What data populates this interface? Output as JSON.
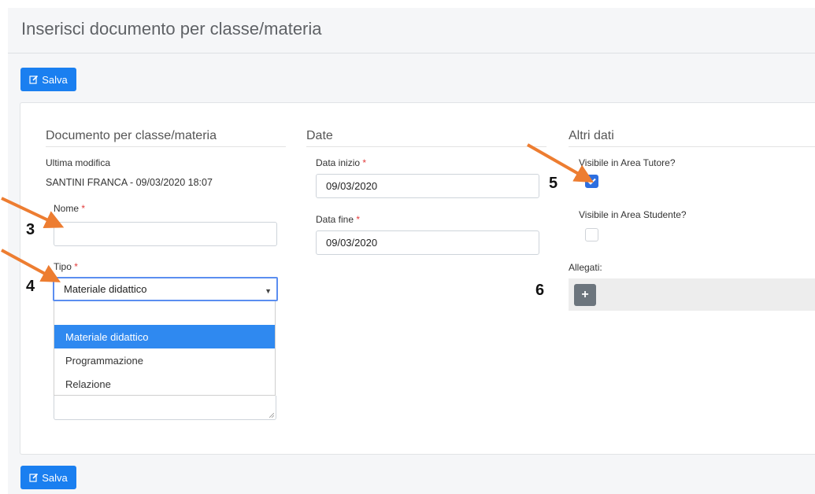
{
  "header": {
    "title": "Inserisci documento per classe/materia"
  },
  "toolbar": {
    "save_label": "Salva"
  },
  "footer": {
    "save_label": "Salva"
  },
  "sections": {
    "documento": {
      "title": "Documento per classe/materia",
      "last_modified_label": "Ultima modifica",
      "last_modified_value": "SANTINI FRANCA - 09/03/2020 18:07",
      "nome_label": "Nome",
      "nome_value": "",
      "tipo_label": "Tipo",
      "tipo_selected": "Materiale didattico",
      "tipo_options": [
        "Materiale didattico",
        "Programmazione",
        "Relazione"
      ]
    },
    "date": {
      "title": "Date",
      "start_label": "Data inizio",
      "start_value": "09/03/2020",
      "end_label": "Data fine",
      "end_value": "09/03/2020"
    },
    "altri": {
      "title": "Altri dati",
      "tutore_label": "Visibile in Area Tutore?",
      "tutore_checked": true,
      "studente_label": "Visibile in Area Studente?",
      "studente_checked": false,
      "allegati_label": "Allegati:"
    }
  },
  "required_mark": "*",
  "annotations": [
    "3",
    "4",
    "5",
    "6"
  ],
  "colors": {
    "primary": "#1a7ff0",
    "annotation_arrow": "#ed7d31",
    "required": "#e23c3c",
    "selected_option": "#2f89f0"
  }
}
